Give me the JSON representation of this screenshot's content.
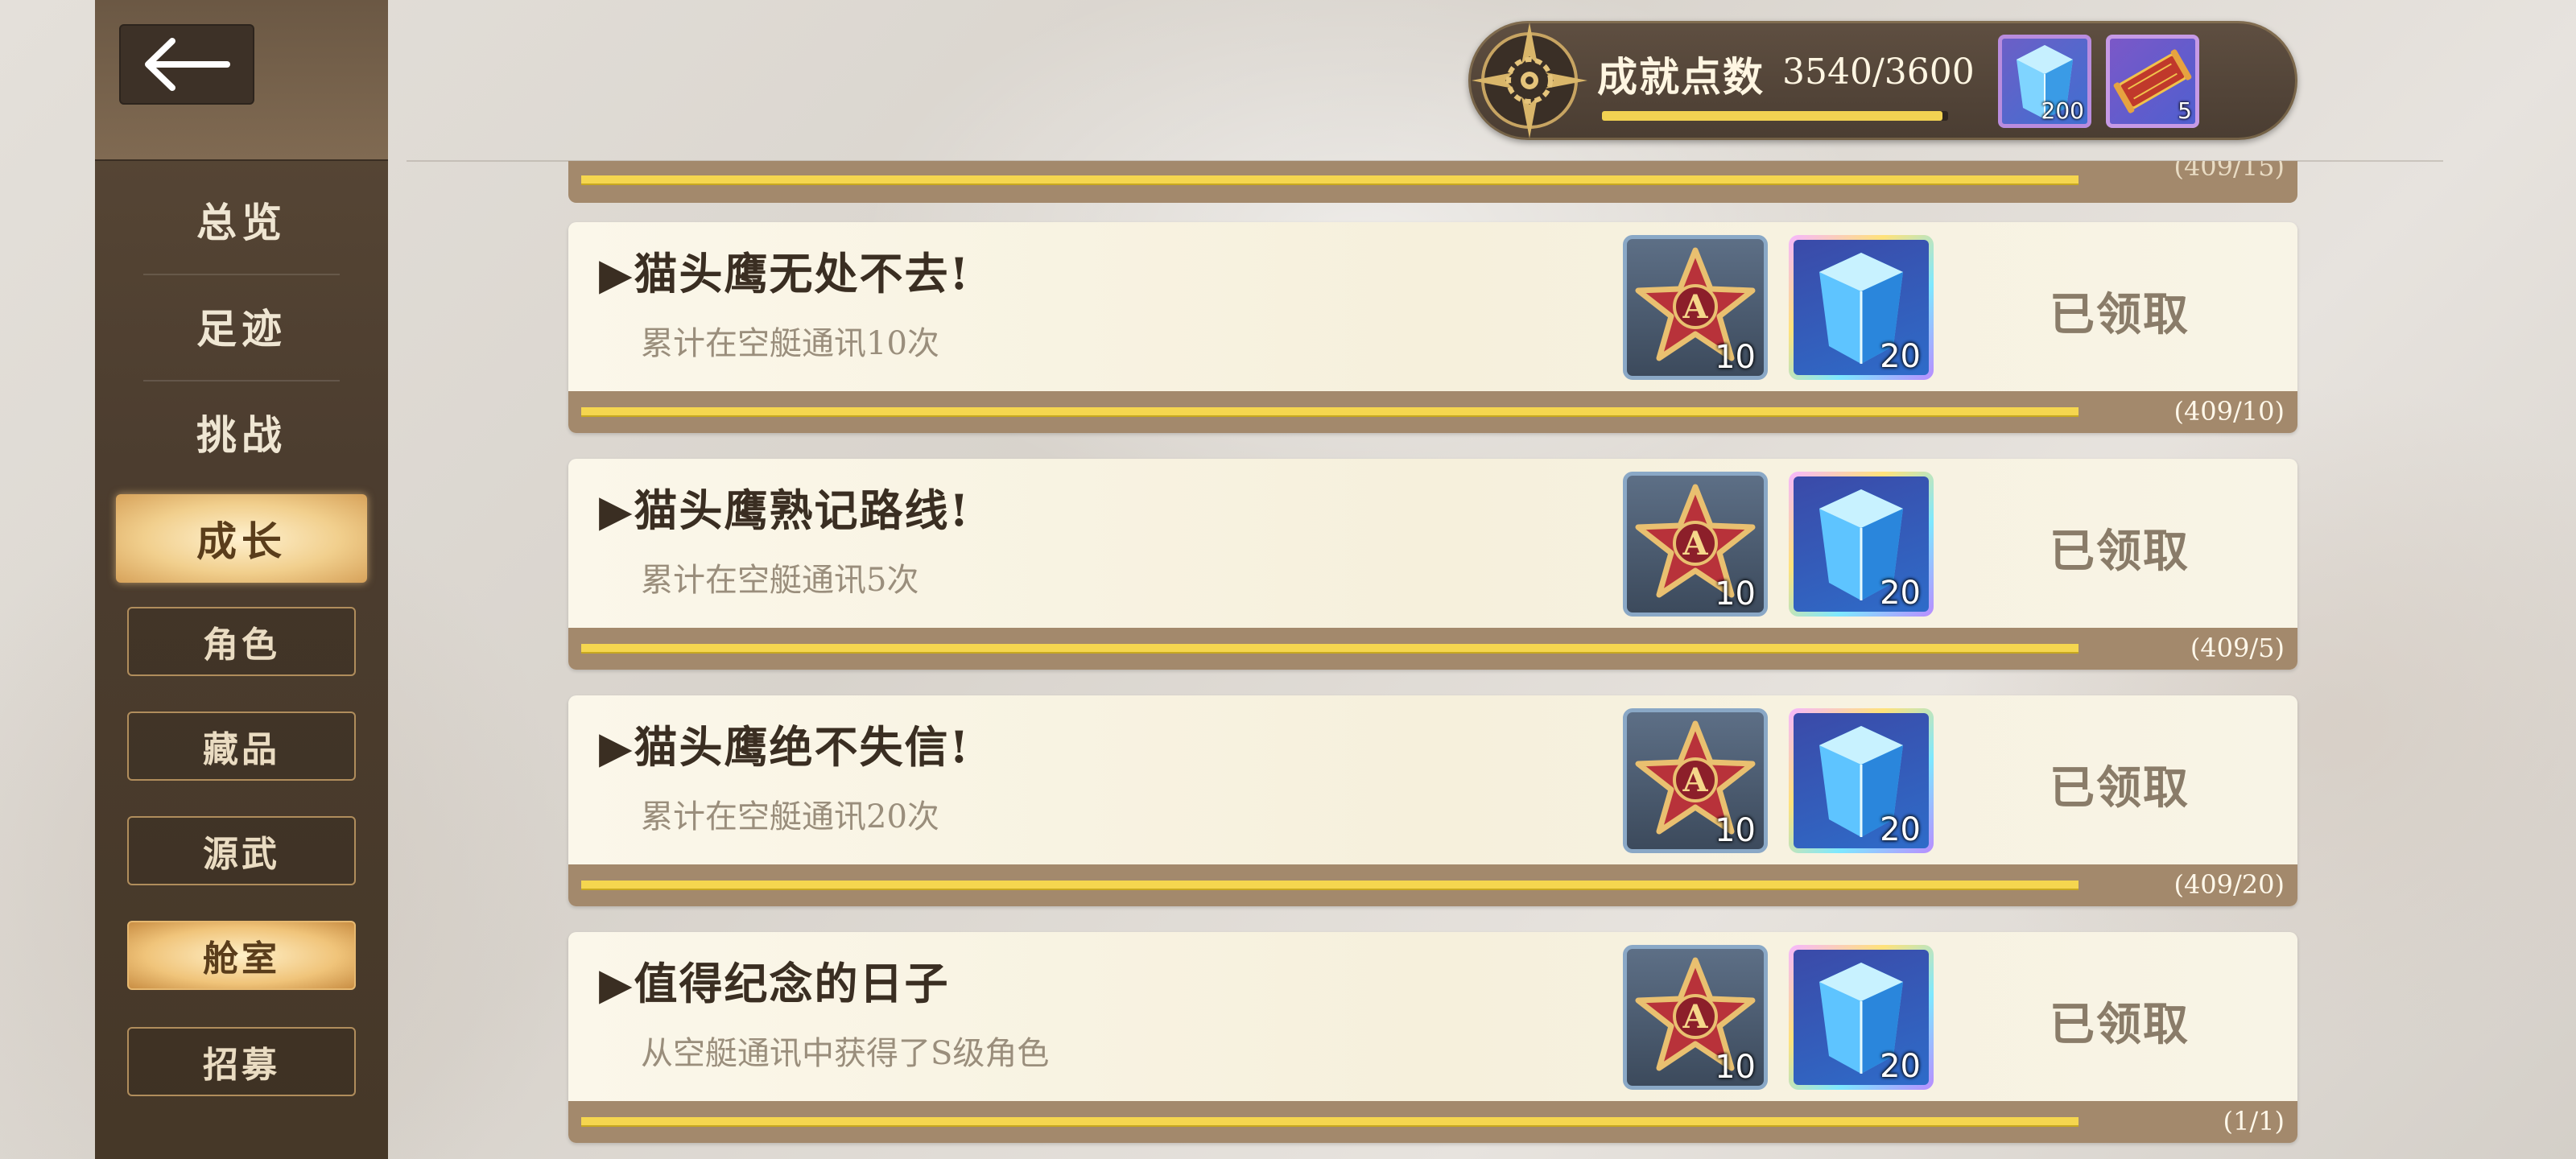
{
  "nav": {
    "back_icon": "arrow-left-icon",
    "main_items": [
      "总览",
      "足迹",
      "挑战",
      "成长"
    ],
    "active_main": "成长",
    "sub_items": [
      "角色",
      "藏品",
      "源武",
      "舱室",
      "招募"
    ],
    "active_sub": "舱室"
  },
  "header": {
    "points_label": "成就点数",
    "points_value": "3540/3600",
    "points_progress": 0.983,
    "emblem_icon": "gear-compass-emblem-icon",
    "items": [
      {
        "icon": "blue-crystal-icon",
        "qty": "200"
      },
      {
        "icon": "red-scroll-icon",
        "qty": "5"
      }
    ]
  },
  "partial_card": {
    "count": "(409/15)",
    "progress": 1.0
  },
  "achievements": [
    {
      "title": "▶猫头鹰无处不去!",
      "desc": "累计在空艇通讯10次",
      "rewards": [
        {
          "icon": "a-star-badge-icon",
          "qty": "10"
        },
        {
          "icon": "blue-crystal-icon",
          "qty": "20"
        }
      ],
      "status": "已领取",
      "count": "(409/10)",
      "progress": 1.0
    },
    {
      "title": "▶猫头鹰熟记路线!",
      "desc": "累计在空艇通讯5次",
      "rewards": [
        {
          "icon": "a-star-badge-icon",
          "qty": "10"
        },
        {
          "icon": "blue-crystal-icon",
          "qty": "20"
        }
      ],
      "status": "已领取",
      "count": "(409/5)",
      "progress": 1.0
    },
    {
      "title": "▶猫头鹰绝不失信!",
      "desc": "累计在空艇通讯20次",
      "rewards": [
        {
          "icon": "a-star-badge-icon",
          "qty": "10"
        },
        {
          "icon": "blue-crystal-icon",
          "qty": "20"
        }
      ],
      "status": "已领取",
      "count": "(409/20)",
      "progress": 1.0
    },
    {
      "title": "▶值得纪念的日子",
      "desc": "从空艇通讯中获得了S级角色",
      "rewards": [
        {
          "icon": "a-star-badge-icon",
          "qty": "10"
        },
        {
          "icon": "blue-crystal-icon",
          "qty": "20"
        }
      ],
      "status": "已领取",
      "count": "(1/1)",
      "progress": 1.0
    }
  ]
}
